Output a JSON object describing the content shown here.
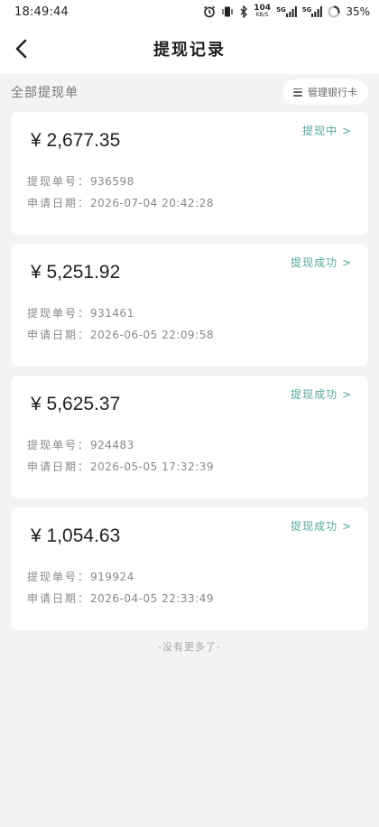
{
  "status_bar": {
    "time": "18:49:44",
    "net_speed_top": "104",
    "net_speed_bottom": "KB/S",
    "signal1": "5G",
    "signal2": "5G",
    "battery": "35%"
  },
  "header": {
    "title": "提现记录"
  },
  "toolbar": {
    "filter_label": "全部提现单",
    "manage_label": "管理银行卡"
  },
  "records": [
    {
      "amount": "¥ 2,677.35",
      "status": "提现中 >",
      "order_label": "提现单号：",
      "order_no": "936598",
      "date_label": "申请日期：",
      "date": "2026-07-04 20:42:28"
    },
    {
      "amount": "¥ 5,251.92",
      "status": "提现成功 >",
      "order_label": "提现单号：",
      "order_no": "931461",
      "date_label": "申请日期：",
      "date": "2026-06-05 22:09:58"
    },
    {
      "amount": "¥ 5,625.37",
      "status": "提现成功 >",
      "order_label": "提现单号：",
      "order_no": "924483",
      "date_label": "申请日期：",
      "date": "2026-05-05 17:32:39"
    },
    {
      "amount": "¥ 1,054.63",
      "status": "提现成功 >",
      "order_label": "提现单号：",
      "order_no": "919924",
      "date_label": "申请日期：",
      "date": "2026-04-05 22:33:49"
    }
  ],
  "footer": {
    "no_more": "-没有更多了-"
  },
  "colors": {
    "status_accent": "#59a7a0",
    "background": "#f3f3f3",
    "card": "#ffffff"
  }
}
